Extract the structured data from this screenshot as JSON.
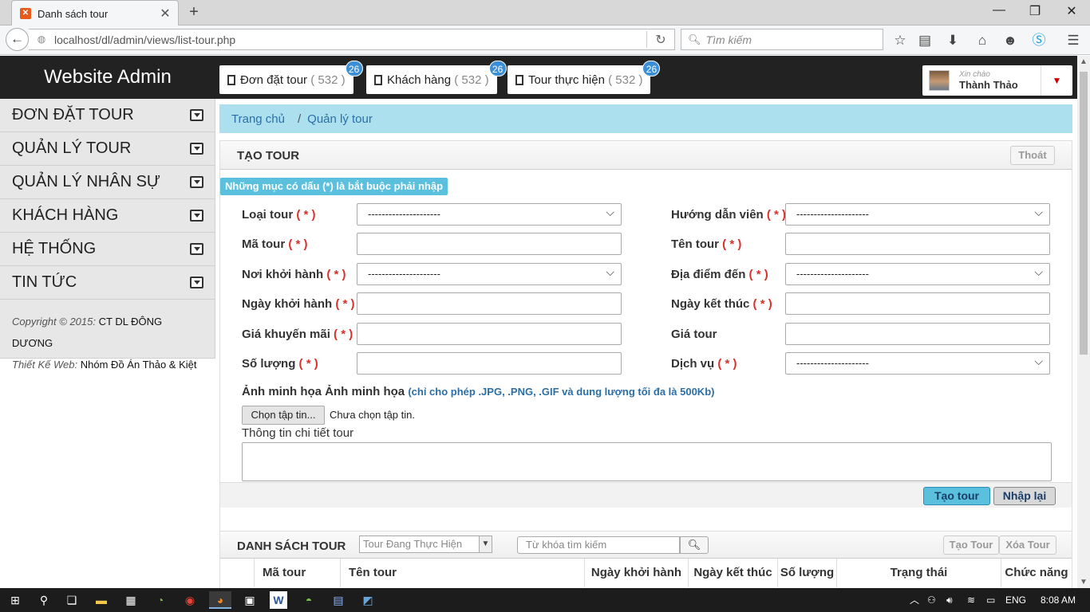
{
  "browser": {
    "tab_title": "Danh sách tour",
    "url": "localhost/dl/admin/views/list-tour.php",
    "search_placeholder": "Tìm kiếm"
  },
  "header": {
    "brand": "Website Admin",
    "tabs": [
      {
        "label": "Đơn đặt tour",
        "count": "( 532 )",
        "badge": "26"
      },
      {
        "label": "Khách hàng",
        "count": "( 532 )",
        "badge": "26"
      },
      {
        "label": "Tour thực hiện",
        "count": "( 532 )",
        "badge": "26"
      }
    ],
    "user": {
      "greeting": "Xin chào",
      "name": "Thành Thảo"
    }
  },
  "sidebar": {
    "items": [
      {
        "label": "ĐƠN ĐẶT TOUR"
      },
      {
        "label": "QUẢN LÝ TOUR"
      },
      {
        "label": "QUẢN LÝ NHÂN SỰ"
      },
      {
        "label": "KHÁCH HÀNG"
      },
      {
        "label": "HỆ THỐNG"
      },
      {
        "label": "TIN TỨC"
      }
    ],
    "copyright_label": "Copyright © 2015:",
    "copyright_value": "CT DL ĐÔNG DƯƠNG",
    "design_label": "Thiết Kế Web:",
    "design_value": "Nhóm Đồ Án Thảo & Kiệt"
  },
  "breadcrumb": {
    "home": "Trang chủ",
    "separator": "/",
    "current": "Quản lý tour"
  },
  "create_panel": {
    "title": "TẠO TOUR",
    "exit_label": "Thoát",
    "notice": "Những mục có dấu (*) là bắt buộc phải nhập",
    "required_mark": "( * )",
    "select_placeholder": "---------------------",
    "fields": {
      "loai_tour": "Loại tour",
      "huong_dan_vien": "Hướng dẫn viên",
      "ma_tour": "Mã tour",
      "ten_tour": "Tên tour",
      "noi_khoi_hanh": "Nơi khởi hành",
      "dia_diem_den": "Địa điểm đến",
      "ngay_khoi_hanh": "Ngày khởi hành",
      "ngay_ket_thuc": "Ngày kết thúc",
      "gia_khuyen_mai": "Giá khuyến mãi",
      "gia_tour": "Giá tour",
      "so_luong": "Số lượng",
      "dich_vu": "Dịch vụ"
    },
    "image_label": "Ảnh minh họa Ảnh minh họa",
    "image_hint": "(chỉ cho phép .JPG, .PNG, .GIF và dung lượng tối đa là 500Kb)",
    "file_button": "Chọn tập tin...",
    "file_status": "Chưa chọn tập tin.",
    "detail_label": "Thông tin chi tiết tour",
    "create_button": "Tạo tour",
    "reset_button": "Nhập lại"
  },
  "list_panel": {
    "title": "DANH SÁCH TOUR",
    "filter_value": "Tour Đang Thực Hiện",
    "search_placeholder": "Từ khóa tìm kiếm",
    "create_button": "Tạo Tour",
    "delete_button": "Xóa Tour",
    "columns": [
      "Mã tour",
      "Tên tour",
      "Ngày khởi hành",
      "Ngày kết thúc",
      "Số lượng",
      "Trạng thái",
      "Chức năng"
    ]
  },
  "taskbar": {
    "language": "ENG",
    "time": "8:08 AM"
  }
}
